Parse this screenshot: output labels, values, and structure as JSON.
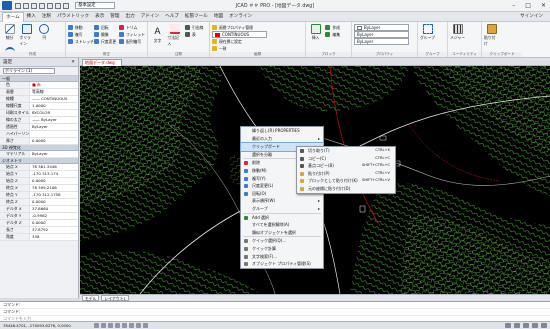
{
  "window": {
    "title": "JCAD ＃＃ PRO - [地図データ.dwg]",
    "quick_access_combo": "基本設定",
    "minimize": "–",
    "maximize": "□",
    "close": "✕"
  },
  "menubar": {
    "items": [
      "ホーム",
      "挿入",
      "注釈",
      "パラメトリック",
      "表示",
      "管理",
      "出力",
      "アドイン",
      "ヘルプ",
      "拡張ツール",
      "地図",
      "オンライン"
    ],
    "right_item": "サインイン"
  },
  "ribbon": {
    "groups": [
      {
        "name": "作成",
        "buttons": [
          "線分",
          "ポリライン",
          "円",
          "円弧"
        ]
      },
      {
        "name": "修正",
        "small": [
          "移動",
          "回転",
          "トリム",
          "複写",
          "鏡像",
          "フィレット",
          "ストレッチ",
          "尺度変更",
          "配列複写"
        ]
      },
      {
        "name": "注釈",
        "buttons": [
          "文字",
          "寸法記入"
        ],
        "small": [
          "引出線",
          "表"
        ]
      },
      {
        "name": "画層",
        "layer_value": "CONTINUOUS",
        "small": [
          "画層プロパティ管理",
          "現在層に設定",
          "一致"
        ]
      },
      {
        "name": "ブロック",
        "buttons": [
          "挿入"
        ],
        "small": [
          "作成",
          "編集"
        ]
      },
      {
        "name": "プロパティ",
        "small": [
          "ByLayer",
          "ByLayer",
          "ByLayer"
        ]
      },
      {
        "name": "グループ",
        "buttons": [
          "グループ"
        ]
      },
      {
        "name": "ユーティリティ",
        "buttons": [
          "メジャー"
        ]
      },
      {
        "name": "クリップボード",
        "buttons": [
          "貼り付け"
        ]
      }
    ]
  },
  "properties_panel": {
    "title": "設定",
    "selection": "ポリライン (1)",
    "sections": [
      {
        "name": "一般",
        "rows": [
          {
            "k": "色",
            "v": "■ 赤"
          },
          {
            "k": "画層",
            "v": "等高線"
          },
          {
            "k": "線種",
            "v": "—— CONTINUOUS"
          },
          {
            "k": "線種尺度",
            "v": "1.0000"
          },
          {
            "k": "印刷スタイル",
            "v": "BYCOLOR"
          },
          {
            "k": "線の太さ",
            "v": "—— ByLayer"
          },
          {
            "k": "透過性",
            "v": "ByLayer"
          },
          {
            "k": "ハイパーリンク",
            "v": ""
          },
          {
            "k": "厚さ",
            "v": "0.0000"
          }
        ]
      },
      {
        "name": "3D 視覚化",
        "rows": [
          {
            "k": "マテリアル",
            "v": "ByLayer"
          }
        ]
      },
      {
        "name": "ジオメトリ",
        "rows": [
          {
            "k": "始点 X",
            "v": "78 361.3446"
          },
          {
            "k": "始点 Y",
            "v": "-170 313.174"
          },
          {
            "k": "始点 Z",
            "v": "0.0000"
          },
          {
            "k": "終点 X",
            "v": "78 399.2106"
          },
          {
            "k": "終点 Y",
            "v": "-170 312.1758"
          },
          {
            "k": "終点 Z",
            "v": "0.0000"
          },
          {
            "k": "デルタ X",
            "v": "37.8660"
          },
          {
            "k": "デルタ Y",
            "v": "-0.9982"
          },
          {
            "k": "デルタ Z",
            "v": "0.0000"
          },
          {
            "k": "長さ",
            "v": "37.8792"
          },
          {
            "k": "角度",
            "v": "358"
          }
        ]
      }
    ]
  },
  "document_tab": "地図データ.dwg",
  "context_menu": {
    "items": [
      {
        "label": "繰り返し(R) PROPERTIES",
        "sep_after": false
      },
      {
        "label": "最近の入力",
        "arrow": true,
        "sep_after": true
      },
      {
        "label": "クリップボード",
        "arrow": true,
        "selected": true,
        "sep_after": false
      },
      {
        "label": "選択を分離",
        "arrow": true,
        "sep_after": true
      },
      {
        "label": "削除",
        "sep_after": false
      },
      {
        "label": "移動(M)",
        "sep_after": false
      },
      {
        "label": "複写(Y)",
        "sep_after": false
      },
      {
        "label": "尺度変更(L)",
        "sep_after": false
      },
      {
        "label": "回転(O)",
        "sep_after": false
      },
      {
        "label": "表示順序(W)",
        "arrow": true,
        "sep_after": false
      },
      {
        "label": "グループ",
        "arrow": true,
        "sep_after": true
      },
      {
        "label": "Add 選択",
        "sep_after": false
      },
      {
        "label": "すべてを選択解除(A)",
        "sep_after": false
      },
      {
        "label": "類似オブジェクトを選択",
        "sep_after": true
      },
      {
        "label": "クイック選択(Q)...",
        "sep_after": false
      },
      {
        "label": "クイック計算",
        "sep_after": false
      },
      {
        "label": "文字検索(F)...",
        "sep_after": false
      },
      {
        "label": "オブジェクト プロパティ管理(S)",
        "sep_after": false
      }
    ],
    "submenu": [
      {
        "label": "切り取り(T)",
        "shortcut": "CTRL+X"
      },
      {
        "label": "コピー(C)",
        "shortcut": "CTRL+C"
      },
      {
        "label": "基点コピー(B)",
        "shortcut": "SHIFT+CTRL+C"
      },
      {
        "label": "貼り付け(P)",
        "shortcut": "CTRL+V"
      },
      {
        "label": "ブロックとして貼り付け(K)",
        "shortcut": "SHIFT+CTRL+V"
      },
      {
        "label": "元の座標に貼り付け(D)",
        "shortcut": ""
      }
    ]
  },
  "layout_tabs": [
    "モデル",
    "レイアウト1"
  ],
  "command_line": {
    "lines": [
      "コマンド:",
      "コマンド:"
    ],
    "prompt": "コマンドを入力"
  },
  "status": {
    "coords": "78446.4701, -170093.6276, 0.0000"
  },
  "colors": {
    "canvas_bg": "#000000",
    "contour_green": "#4caf3a",
    "contour_bright": "#8fe05a",
    "road_white": "#e8e8e8",
    "accent_red": "#e01010"
  }
}
